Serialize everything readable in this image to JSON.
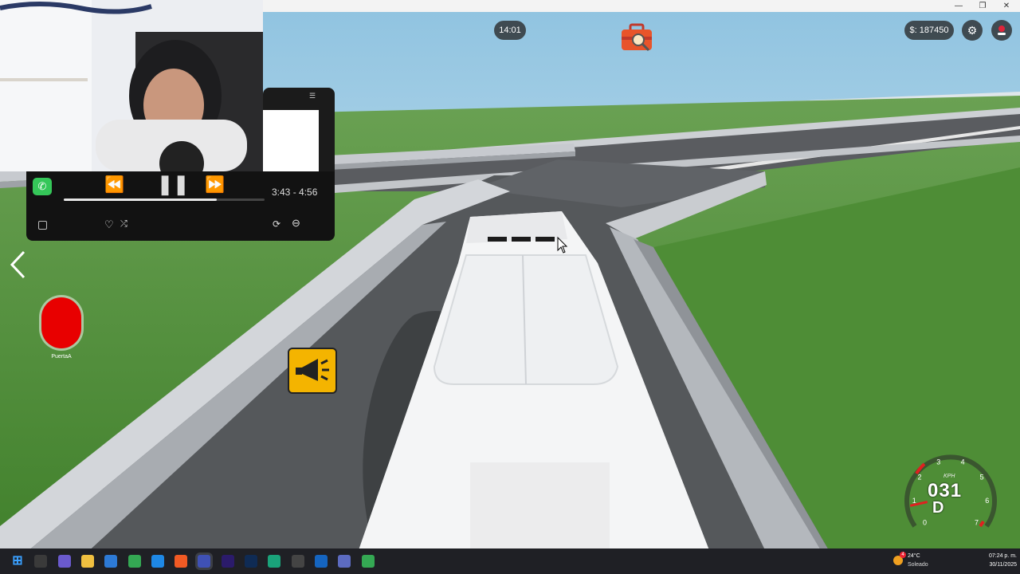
{
  "hud": {
    "clock": "14:01",
    "money": "$: 187450",
    "settings_icon": "gear-icon",
    "record_icon": "record-icon",
    "jobs_icon": "briefcase-search-icon",
    "horn_icon": "megaphone-icon",
    "door_button_label": "PuertaA"
  },
  "music": {
    "time": "3:43 - 4:56",
    "progress": 0.76,
    "app_icon": "phone-icon"
  },
  "speedometer": {
    "unit": "KPH",
    "speed": "031",
    "gear": "D",
    "ticks": [
      "0",
      "1",
      "2",
      "3",
      "4",
      "5",
      "6",
      "7"
    ],
    "needle_fraction": 0.12
  },
  "taskbar": {
    "weather_temp": "24°C",
    "weather_desc": "Soleado",
    "weather_badge": "4",
    "time": "07:24 p. m.",
    "date": "30/11/2025",
    "apps": [
      "windows-start-icon",
      "task-view-icon",
      "copilot-icon",
      "file-explorer-icon",
      "store-icon",
      "chrome-icon",
      "edge-icon",
      "brave-icon",
      "roblox-icon",
      "premiere-icon",
      "photoshop-icon",
      "capcut-icon",
      "obs-icon",
      "elephant-icon",
      "app-icon",
      "chrome-profile-icon"
    ]
  },
  "colors": {
    "sky_top": "#8fc3e0",
    "sky_bottom": "#dfeff6",
    "grass": "#4d8c35",
    "road": "#55585b",
    "barrier": "#c9ccd0",
    "bus": "#f4f5f6",
    "door_button": "#e80000",
    "horn_bg": "#f4b400"
  }
}
